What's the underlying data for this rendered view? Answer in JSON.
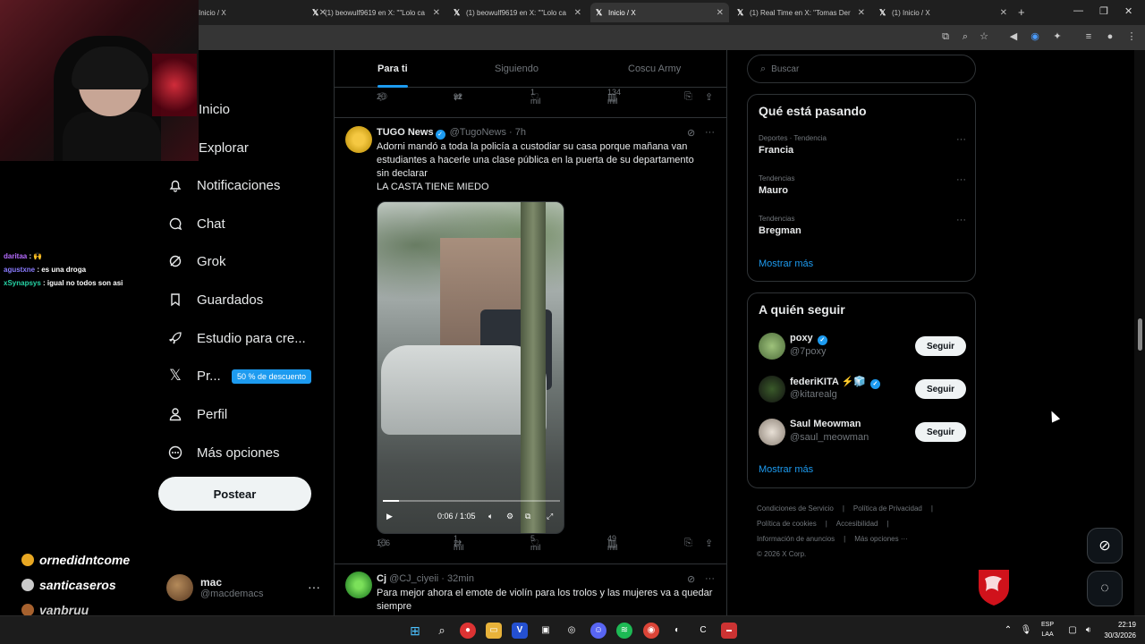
{
  "browser": {
    "tabs": [
      {
        "title": "Inicio / X",
        "active": false
      },
      {
        "title": "(1) beowulf9619 en X: \"\"Lolo ca",
        "active": false
      },
      {
        "title": "(1) beowulf9619 en X: \"\"Lolo ca",
        "active": false
      },
      {
        "title": "Inicio / X",
        "active": true
      },
      {
        "title": "(1) Real Time en X: \"Tomas Der",
        "active": false
      },
      {
        "title": "(1) Inicio / X",
        "active": false
      }
    ],
    "new_tab": "+",
    "close_glyph": "✕"
  },
  "stream": {
    "chat": [
      {
        "user": "daritaa",
        "text": " : 🙌"
      },
      {
        "user": "agustxne",
        "text": " : es una droga"
      },
      {
        "user": "xSynapsys",
        "text": " : igual no todos son asi"
      }
    ],
    "subs": [
      "ornedidntcome",
      "santicaseros",
      "vanbruu"
    ]
  },
  "nav": {
    "items": [
      {
        "label": "Inicio",
        "icon": "home-icon"
      },
      {
        "label": "Explorar",
        "icon": "search-icon"
      },
      {
        "label": "Notificaciones",
        "icon": "bell-icon"
      },
      {
        "label": "Chat",
        "icon": "chat-icon"
      },
      {
        "label": "Grok",
        "icon": "grok-icon"
      },
      {
        "label": "Guardados",
        "icon": "bookmark-icon"
      },
      {
        "label": "Estudio para cre...",
        "icon": "rocket-icon"
      },
      {
        "label": "Pr...",
        "icon": "x-logo-icon"
      },
      {
        "label": "Perfil",
        "icon": "person-icon"
      },
      {
        "label": "Más opciones",
        "icon": "more-circle-icon"
      }
    ],
    "premium_promo": "50 % de descuento",
    "post_button": "Postear",
    "account": {
      "name": "mac",
      "handle": "@macdemacs",
      "more": "···"
    }
  },
  "feed": {
    "tabs": [
      {
        "label": "Para ti",
        "selected": true
      },
      {
        "label": "Siguiendo",
        "selected": false
      },
      {
        "label": "Coscu Army",
        "selected": false
      }
    ],
    "prev_actions": {
      "replies": "20",
      "reposts": "92",
      "likes": "1 mil",
      "views": "134 mil"
    },
    "tweet1": {
      "name": "TUGO News",
      "handle": "@TugoNews · 7h",
      "text_lines": [
        "Adorni mandó a toda la policía a custodiar su casa porque mañana van",
        "estudiantes a hacerle una clase pública en la puerta de su departamento",
        "sin declarar",
        "LA CASTA TIENE MIEDO"
      ],
      "video": {
        "time": "0:06 / 1:05",
        "progress": 0.09
      },
      "actions": {
        "replies": "106",
        "reposts": "1 mil",
        "likes": "5 mil",
        "views": "49 mil"
      }
    },
    "tweet2": {
      "name": "Cj",
      "handle": "@CJ_ciyeii · 32min",
      "text_lines": [
        "Para mejor ahora el emote de violín para los trolos y las mujeres va a quedar",
        "siempre"
      ]
    }
  },
  "sidebar": {
    "search_placeholder": "Buscar",
    "trends": {
      "title": "Qué está pasando",
      "items": [
        {
          "context": "Deportes · Tendencia",
          "name": "Francia"
        },
        {
          "context": "Tendencias",
          "name": "Mauro"
        },
        {
          "context": "Tendencias",
          "name": "Bregman"
        }
      ],
      "show_more": "Mostrar más"
    },
    "who_to_follow": {
      "title": "A quién seguir",
      "items": [
        {
          "name": "poxy",
          "handle": "@7poxy",
          "verified": true
        },
        {
          "name": "federiKITA ⚡🧊",
          "handle": "@kitarealg",
          "verified": true
        },
        {
          "name": "Saul Meowman",
          "handle": "@saul_meowman",
          "verified": false
        }
      ],
      "follow_label": "Seguir",
      "show_more": "Mostrar más"
    },
    "footer": {
      "links": [
        "Condiciones de Servicio",
        "|",
        "Política de Privacidad",
        "|",
        "Política de cookies",
        "|",
        "Accesibilidad",
        "|",
        "Información de anuncios",
        "|",
        "Más opciones ···"
      ],
      "copyright": "© 2026 X Corp."
    }
  },
  "taskbar": {
    "lang_top": "ESP",
    "lang_bottom": "LAA",
    "time": "22:19",
    "date": "30/3/2026"
  },
  "colors": {
    "accent": "#1d9bf0",
    "background": "#000000",
    "border": "#2f3336",
    "muted": "#71767b"
  }
}
